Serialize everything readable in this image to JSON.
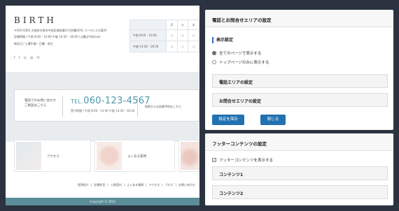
{
  "preview": {
    "logo": "BIRTH",
    "address_lines": [
      "〒620-0302 大阪府大阪市中央区南船場3丁目6番20号 パーキビル大阪3F",
      "診療時間 / 午前 8:00 - 13:00  午後 14:30 - 18:30 (土曜は午前のみ)",
      "休診日 / 土曜午後・日曜・祝日"
    ],
    "social_icons": [
      "facebook-icon",
      "twitter-icon",
      "instagram-icon",
      "line-icon",
      "mail-icon"
    ],
    "hours_table": {
      "header": [
        "",
        "月",
        "火",
        "水"
      ],
      "rows": [
        {
          "label": "午前 8:00 - 13:00",
          "cells": [
            "○",
            "○",
            "○"
          ]
        },
        {
          "label": "午後 14:30 - 18:30",
          "cells": [
            "○",
            "○",
            "○"
          ]
        }
      ]
    },
    "contact": {
      "intro_line1": "電話でのお問い合わせ",
      "intro_line2": "ご相談はこちら",
      "tel_prefix": "TEL.",
      "tel_number": "060-123-4567",
      "tel_note": "受付時間 / 午前 8:00 - 13:00 午後 14:30 - 18:30",
      "other": "他院からの診療予約はこちら"
    },
    "cards": [
      {
        "label": "アクセス"
      },
      {
        "label": "よくある質問"
      },
      {
        "label": ""
      }
    ],
    "footer_nav": [
      "医院紹介",
      "診療科目",
      "入院案内",
      "よくある質問",
      "アクセス",
      "ブログ",
      "お問い合わせ"
    ],
    "copyright": "Copyright © 2018"
  },
  "panel1": {
    "title": "電話とお問合せエリアの設定",
    "section": "表示設定",
    "options": [
      {
        "label": "全てのページで表示する",
        "selected": true
      },
      {
        "label": "トップページのみに表示する",
        "selected": false
      }
    ],
    "accordions": [
      "電話エリアの設定",
      "お問合せエリアの設定"
    ],
    "save_label": "設定を保存",
    "close_label": "閉じる"
  },
  "panel2": {
    "title": "フッターコンテンツの設定",
    "checkbox_label": "フッターコンテンツを表示する",
    "checkbox_checked": true,
    "accordions": [
      "コンテンツ1",
      "コンテンツ2"
    ]
  },
  "colors": {
    "accent_blue": "#2271b1",
    "tel_teal": "#4c97a8",
    "footer_teal": "#5c8e99",
    "backdrop": "#2c3340"
  }
}
